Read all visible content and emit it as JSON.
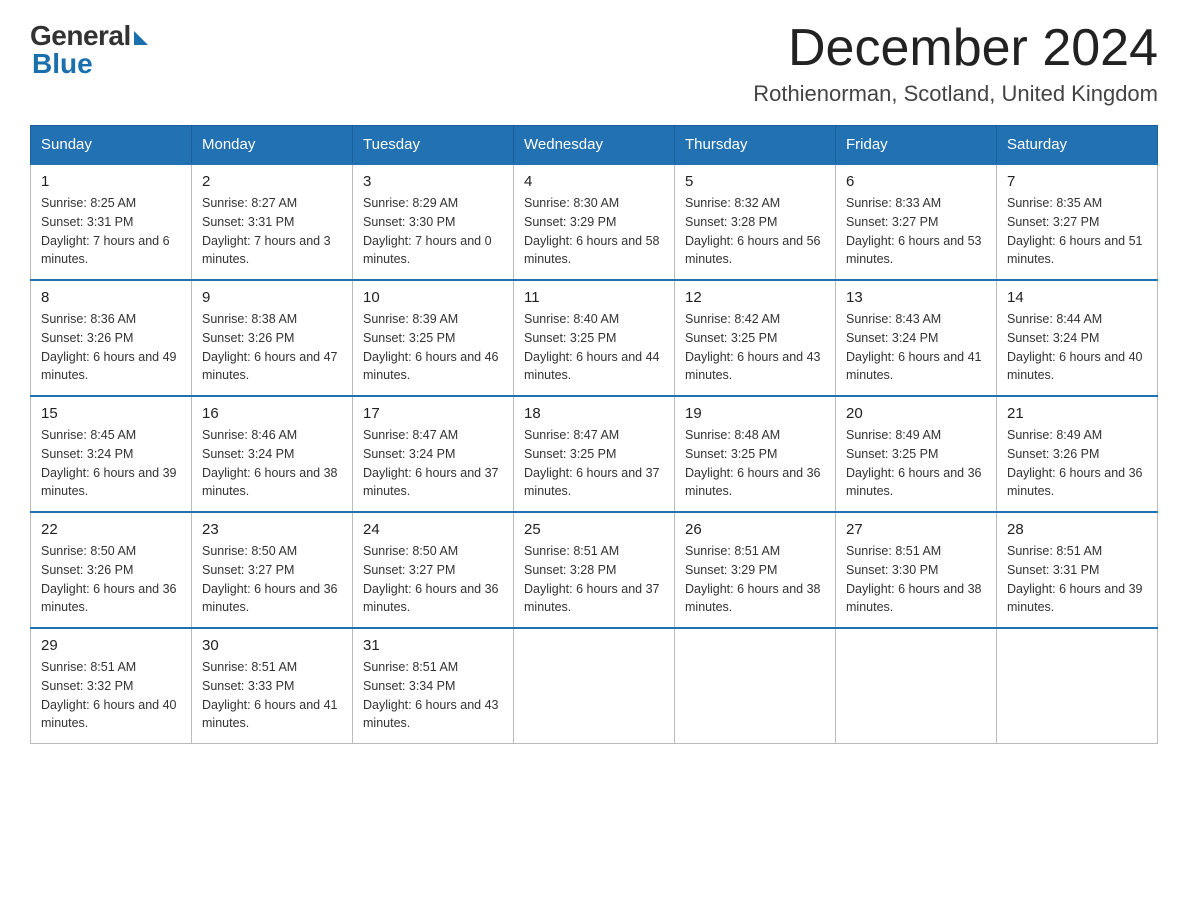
{
  "logo": {
    "general": "General",
    "blue": "Blue"
  },
  "title": "December 2024",
  "location": "Rothienorman, Scotland, United Kingdom",
  "days_of_week": [
    "Sunday",
    "Monday",
    "Tuesday",
    "Wednesday",
    "Thursday",
    "Friday",
    "Saturday"
  ],
  "weeks": [
    [
      {
        "day": "1",
        "sunrise": "8:25 AM",
        "sunset": "3:31 PM",
        "daylight": "7 hours and 6 minutes."
      },
      {
        "day": "2",
        "sunrise": "8:27 AM",
        "sunset": "3:31 PM",
        "daylight": "7 hours and 3 minutes."
      },
      {
        "day": "3",
        "sunrise": "8:29 AM",
        "sunset": "3:30 PM",
        "daylight": "7 hours and 0 minutes."
      },
      {
        "day": "4",
        "sunrise": "8:30 AM",
        "sunset": "3:29 PM",
        "daylight": "6 hours and 58 minutes."
      },
      {
        "day": "5",
        "sunrise": "8:32 AM",
        "sunset": "3:28 PM",
        "daylight": "6 hours and 56 minutes."
      },
      {
        "day": "6",
        "sunrise": "8:33 AM",
        "sunset": "3:27 PM",
        "daylight": "6 hours and 53 minutes."
      },
      {
        "day": "7",
        "sunrise": "8:35 AM",
        "sunset": "3:27 PM",
        "daylight": "6 hours and 51 minutes."
      }
    ],
    [
      {
        "day": "8",
        "sunrise": "8:36 AM",
        "sunset": "3:26 PM",
        "daylight": "6 hours and 49 minutes."
      },
      {
        "day": "9",
        "sunrise": "8:38 AM",
        "sunset": "3:26 PM",
        "daylight": "6 hours and 47 minutes."
      },
      {
        "day": "10",
        "sunrise": "8:39 AM",
        "sunset": "3:25 PM",
        "daylight": "6 hours and 46 minutes."
      },
      {
        "day": "11",
        "sunrise": "8:40 AM",
        "sunset": "3:25 PM",
        "daylight": "6 hours and 44 minutes."
      },
      {
        "day": "12",
        "sunrise": "8:42 AM",
        "sunset": "3:25 PM",
        "daylight": "6 hours and 43 minutes."
      },
      {
        "day": "13",
        "sunrise": "8:43 AM",
        "sunset": "3:24 PM",
        "daylight": "6 hours and 41 minutes."
      },
      {
        "day": "14",
        "sunrise": "8:44 AM",
        "sunset": "3:24 PM",
        "daylight": "6 hours and 40 minutes."
      }
    ],
    [
      {
        "day": "15",
        "sunrise": "8:45 AM",
        "sunset": "3:24 PM",
        "daylight": "6 hours and 39 minutes."
      },
      {
        "day": "16",
        "sunrise": "8:46 AM",
        "sunset": "3:24 PM",
        "daylight": "6 hours and 38 minutes."
      },
      {
        "day": "17",
        "sunrise": "8:47 AM",
        "sunset": "3:24 PM",
        "daylight": "6 hours and 37 minutes."
      },
      {
        "day": "18",
        "sunrise": "8:47 AM",
        "sunset": "3:25 PM",
        "daylight": "6 hours and 37 minutes."
      },
      {
        "day": "19",
        "sunrise": "8:48 AM",
        "sunset": "3:25 PM",
        "daylight": "6 hours and 36 minutes."
      },
      {
        "day": "20",
        "sunrise": "8:49 AM",
        "sunset": "3:25 PM",
        "daylight": "6 hours and 36 minutes."
      },
      {
        "day": "21",
        "sunrise": "8:49 AM",
        "sunset": "3:26 PM",
        "daylight": "6 hours and 36 minutes."
      }
    ],
    [
      {
        "day": "22",
        "sunrise": "8:50 AM",
        "sunset": "3:26 PM",
        "daylight": "6 hours and 36 minutes."
      },
      {
        "day": "23",
        "sunrise": "8:50 AM",
        "sunset": "3:27 PM",
        "daylight": "6 hours and 36 minutes."
      },
      {
        "day": "24",
        "sunrise": "8:50 AM",
        "sunset": "3:27 PM",
        "daylight": "6 hours and 36 minutes."
      },
      {
        "day": "25",
        "sunrise": "8:51 AM",
        "sunset": "3:28 PM",
        "daylight": "6 hours and 37 minutes."
      },
      {
        "day": "26",
        "sunrise": "8:51 AM",
        "sunset": "3:29 PM",
        "daylight": "6 hours and 38 minutes."
      },
      {
        "day": "27",
        "sunrise": "8:51 AM",
        "sunset": "3:30 PM",
        "daylight": "6 hours and 38 minutes."
      },
      {
        "day": "28",
        "sunrise": "8:51 AM",
        "sunset": "3:31 PM",
        "daylight": "6 hours and 39 minutes."
      }
    ],
    [
      {
        "day": "29",
        "sunrise": "8:51 AM",
        "sunset": "3:32 PM",
        "daylight": "6 hours and 40 minutes."
      },
      {
        "day": "30",
        "sunrise": "8:51 AM",
        "sunset": "3:33 PM",
        "daylight": "6 hours and 41 minutes."
      },
      {
        "day": "31",
        "sunrise": "8:51 AM",
        "sunset": "3:34 PM",
        "daylight": "6 hours and 43 minutes."
      },
      null,
      null,
      null,
      null
    ]
  ]
}
